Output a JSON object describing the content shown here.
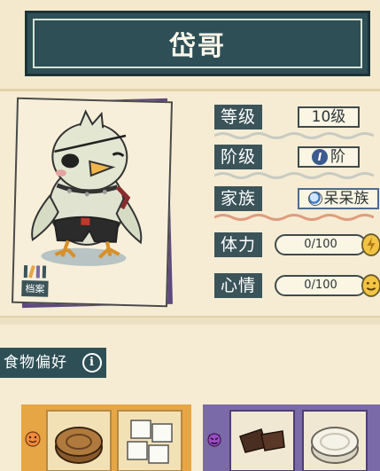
{
  "title": "岱哥",
  "stats": {
    "level": {
      "label": "等级",
      "value": "10级"
    },
    "rank": {
      "label": "阶级",
      "badge": "I",
      "value": "阶"
    },
    "clan": {
      "label": "家族",
      "value": "呆呆族"
    },
    "stamina": {
      "label": "体力",
      "value": "0/100",
      "fraction": 0
    },
    "mood": {
      "label": "心情",
      "value": "0/100",
      "fraction": 0
    }
  },
  "archive": {
    "label": "档案"
  },
  "food": {
    "header": "食物偏好",
    "info_icon": "i",
    "liked": {
      "mood_icon": "happy-face-icon",
      "items": [
        "mooncake-icon",
        "sugar-cubes-icon"
      ]
    },
    "disliked": {
      "mood_icon": "devil-face-icon",
      "items": [
        "chocolate-pieces-icon",
        "white-mooncake-icon"
      ]
    }
  },
  "colors": {
    "accent": "#2e4f56",
    "like": "#e6a646",
    "dislike": "#7b6aa8",
    "background": "#f5ecd3"
  }
}
